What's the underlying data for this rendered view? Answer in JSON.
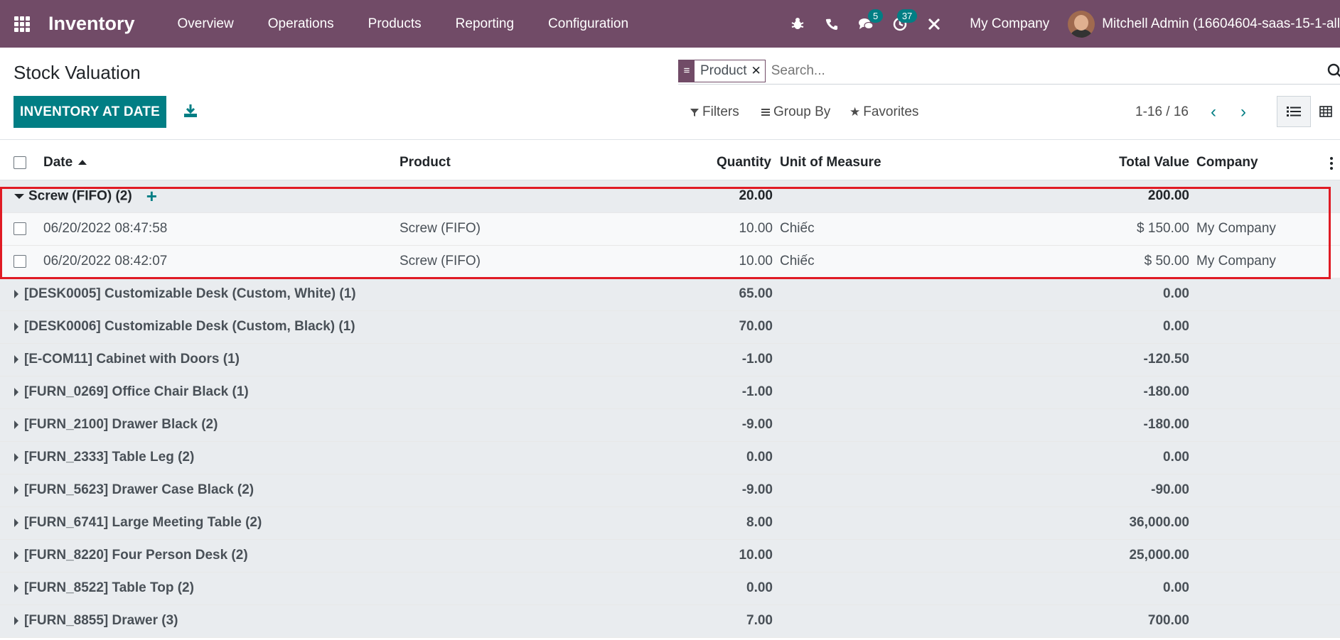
{
  "nav": {
    "app_name": "Inventory",
    "menu": [
      "Overview",
      "Operations",
      "Products",
      "Reporting",
      "Configuration"
    ],
    "messages_count": "5",
    "activities_count": "37",
    "company": "My Company",
    "user": "Mitchell Admin (16604604-saas-15-1-all"
  },
  "control_panel": {
    "title": "Stock Valuation",
    "primary_button": "INVENTORY AT DATE",
    "facet_value": "Product",
    "search_placeholder": "Search...",
    "filters_label": "Filters",
    "groupby_label": "Group By",
    "favorites_label": "Favorites",
    "pager": "1-16 / 16"
  },
  "table": {
    "headers": {
      "date": "Date",
      "product": "Product",
      "quantity": "Quantity",
      "uom": "Unit of Measure",
      "total_value": "Total Value",
      "company": "Company"
    },
    "open_group": {
      "label": "Screw (FIFO) (2)",
      "quantity": "20.00",
      "total_value": "200.00",
      "records": [
        {
          "date": "06/20/2022 08:47:58",
          "product": "Screw (FIFO)",
          "quantity": "10.00",
          "uom": "Chiếc",
          "total_value": "$ 150.00",
          "company": "My Company"
        },
        {
          "date": "06/20/2022 08:42:07",
          "product": "Screw (FIFO)",
          "quantity": "10.00",
          "uom": "Chiếc",
          "total_value": "$ 50.00",
          "company": "My Company"
        }
      ]
    },
    "groups": [
      {
        "label": "[DESK0005] Customizable Desk (Custom, White) (1)",
        "quantity": "65.00",
        "total_value": "0.00"
      },
      {
        "label": "[DESK0006] Customizable Desk (Custom, Black) (1)",
        "quantity": "70.00",
        "total_value": "0.00"
      },
      {
        "label": "[E-COM11] Cabinet with Doors (1)",
        "quantity": "-1.00",
        "total_value": "-120.50"
      },
      {
        "label": "[FURN_0269] Office Chair Black (1)",
        "quantity": "-1.00",
        "total_value": "-180.00"
      },
      {
        "label": "[FURN_2100] Drawer Black (2)",
        "quantity": "-9.00",
        "total_value": "-180.00"
      },
      {
        "label": "[FURN_2333] Table Leg (2)",
        "quantity": "0.00",
        "total_value": "0.00"
      },
      {
        "label": "[FURN_5623] Drawer Case Black (2)",
        "quantity": "-9.00",
        "total_value": "-90.00"
      },
      {
        "label": "[FURN_6741] Large Meeting Table (2)",
        "quantity": "8.00",
        "total_value": "36,000.00"
      },
      {
        "label": "[FURN_8220] Four Person Desk (2)",
        "quantity": "10.00",
        "total_value": "25,000.00"
      },
      {
        "label": "[FURN_8522] Table Top (2)",
        "quantity": "0.00",
        "total_value": "0.00"
      },
      {
        "label": "[FURN_8855] Drawer (3)",
        "quantity": "7.00",
        "total_value": "700.00"
      }
    ]
  }
}
